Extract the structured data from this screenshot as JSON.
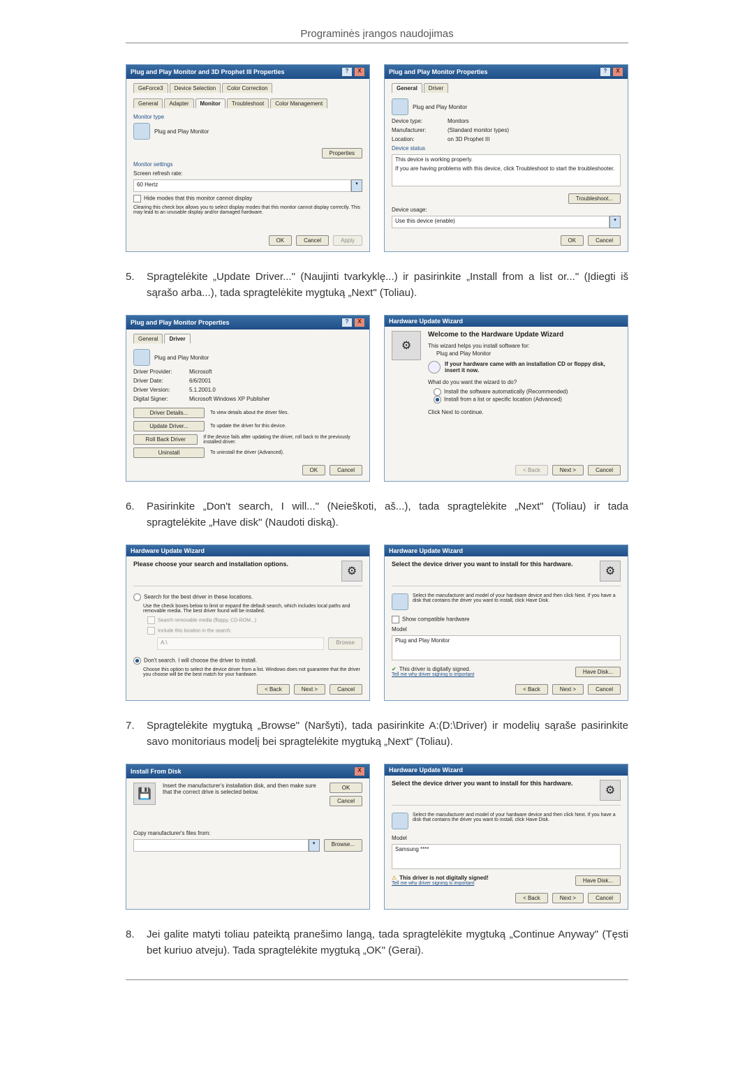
{
  "page_header": "Programinės įrangos naudojimas",
  "win_buttons": {
    "help": "?",
    "close": "X"
  },
  "dlg1": {
    "title": "Plug and Play Monitor and 3D Prophet III Properties",
    "tabs_row1": [
      "GeForce3",
      "Device Selection",
      "Color Correction"
    ],
    "tabs_row2": [
      "General",
      "Adapter",
      "Monitor",
      "Troubleshoot",
      "Color Management"
    ],
    "monitor_type_label": "Monitor type",
    "monitor_type_value": "Plug and Play Monitor",
    "properties_btn": "Properties",
    "monitor_settings_label": "Monitor settings",
    "refresh_label": "Screen refresh rate:",
    "refresh_value": "60 Hertz",
    "hide_modes_label": "Hide modes that this monitor cannot display",
    "hide_modes_desc": "Clearing this check box allows you to select display modes that this monitor cannot display correctly. This may lead to an unusable display and/or damaged hardware.",
    "ok": "OK",
    "cancel": "Cancel",
    "apply": "Apply"
  },
  "dlg2": {
    "title": "Plug and Play Monitor Properties",
    "tabs": [
      "General",
      "Driver"
    ],
    "device_name": "Plug and Play Monitor",
    "kv": [
      [
        "Device type:",
        "Monitors"
      ],
      [
        "Manufacturer:",
        "(Standard monitor types)"
      ],
      [
        "Location:",
        "on 3D Prophet III"
      ]
    ],
    "device_status_label": "Device status",
    "status_line1": "This device is working properly.",
    "status_line2": "If you are having problems with this device, click Troubleshoot to start the troubleshooter.",
    "troubleshoot_btn": "Troubleshoot...",
    "device_usage_label": "Device usage:",
    "device_usage_value": "Use this device (enable)",
    "ok": "OK",
    "cancel": "Cancel"
  },
  "step5": {
    "num": "5.",
    "text": "Spragtelėkite „Update Driver...\" (Naujinti tvarkyklę...) ir pasirinkite „Install from a list or...\" (Įdiegti iš sąrašo arba...), tada spragtelėkite mygtuką „Next\" (Toliau)."
  },
  "dlg3": {
    "title": "Plug and Play Monitor Properties",
    "tabs": [
      "General",
      "Driver"
    ],
    "device_name": "Plug and Play Monitor",
    "kv": [
      [
        "Driver Provider:",
        "Microsoft"
      ],
      [
        "Driver Date:",
        "6/6/2001"
      ],
      [
        "Driver Version:",
        "5.1.2001.0"
      ],
      [
        "Digital Signer:",
        "Microsoft Windows XP Publisher"
      ]
    ],
    "btns": [
      [
        "Driver Details...",
        "To view details about the driver files."
      ],
      [
        "Update Driver...",
        "To update the driver for this device."
      ],
      [
        "Roll Back Driver",
        "If the device fails after updating the driver, roll back to the previously installed driver."
      ],
      [
        "Uninstall",
        "To uninstall the driver (Advanced)."
      ]
    ],
    "ok": "OK",
    "cancel": "Cancel"
  },
  "dlg4": {
    "title": "Hardware Update Wizard",
    "welcome": "Welcome to the Hardware Update Wizard",
    "line1": "This wizard helps you install software for:",
    "device": "Plug and Play Monitor",
    "cd_hint": "If your hardware came with an installation CD or floppy disk, insert it now.",
    "question": "What do you want the wizard to do?",
    "opt1": "Install the software automatically (Recommended)",
    "opt2": "Install from a list or specific location (Advanced)",
    "continue": "Click Next to continue.",
    "back": "< Back",
    "next": "Next >",
    "cancel": "Cancel"
  },
  "step6": {
    "num": "6.",
    "text": "Pasirinkite „Don't search, I will...\" (Neieškoti, aš...), tada spragtelėkite „Next\" (Toliau) ir tada spragtelėkite „Have disk\" (Naudoti diską)."
  },
  "dlg5": {
    "title": "Hardware Update Wizard",
    "header": "Please choose your search and installation options.",
    "opt1": "Search for the best driver in these locations.",
    "opt1_desc": "Use the check boxes below to limit or expand the default search, which includes local paths and removable media. The best driver found will be installed.",
    "chk1": "Search removable media (floppy, CD-ROM...)",
    "chk2": "Include this location in the search:",
    "loc": "A:\\",
    "browse": "Browse",
    "opt2": "Don't search. I will choose the driver to install.",
    "opt2_desc": "Choose this option to select the device driver from a list. Windows does not guarantee that the driver you choose will be the best match for your hardware.",
    "back": "< Back",
    "next": "Next >",
    "cancel": "Cancel"
  },
  "dlg6": {
    "title": "Hardware Update Wizard",
    "header": "Select the device driver you want to install for this hardware.",
    "desc": "Select the manufacturer and model of your hardware device and then click Next. If you have a disk that contains the driver you want to install, click Have Disk.",
    "show_compat": "Show compatible hardware",
    "model_label": "Model",
    "model_value": "Plug and Play Monitor",
    "signed": "This driver is digitally signed.",
    "tell_me": "Tell me why driver signing is important",
    "have_disk": "Have Disk...",
    "back": "< Back",
    "next": "Next >",
    "cancel": "Cancel"
  },
  "step7": {
    "num": "7.",
    "text": "Spragtelėkite mygtuką „Browse\" (Naršyti), tada pasirinkite A:(D:\\Driver) ir modelių sąraše pasirinkite savo monitoriaus modelį bei spragtelėkite mygtuką „Next\" (Toliau)."
  },
  "dlg7": {
    "title": "Install From Disk",
    "msg": "Insert the manufacturer's installation disk, and then make sure that the correct drive is selected below.",
    "ok": "OK",
    "cancel": "Cancel",
    "copy_label": "Copy manufacturer's files from:",
    "browse": "Browse..."
  },
  "dlg8": {
    "title": "Hardware Update Wizard",
    "header": "Select the device driver you want to install for this hardware.",
    "desc": "Select the manufacturer and model of your hardware device and then click Next. If you have a disk that contains the driver you want to install, click Have Disk.",
    "model_label": "Model",
    "model_value": "Samsung ****",
    "not_signed": "This driver is not digitally signed!",
    "tell_me": "Tell me why driver signing is important",
    "have_disk": "Have Disk...",
    "back": "< Back",
    "next": "Next >",
    "cancel": "Cancel"
  },
  "step8": {
    "num": "8.",
    "text": "Jei galite matyti toliau pateiktą pranešimo langą, tada spragtelėkite mygtuką „Continue Anyway\" (Tęsti bet kuriuo atveju). Tada spragtelėkite mygtuką „OK\" (Gerai)."
  }
}
